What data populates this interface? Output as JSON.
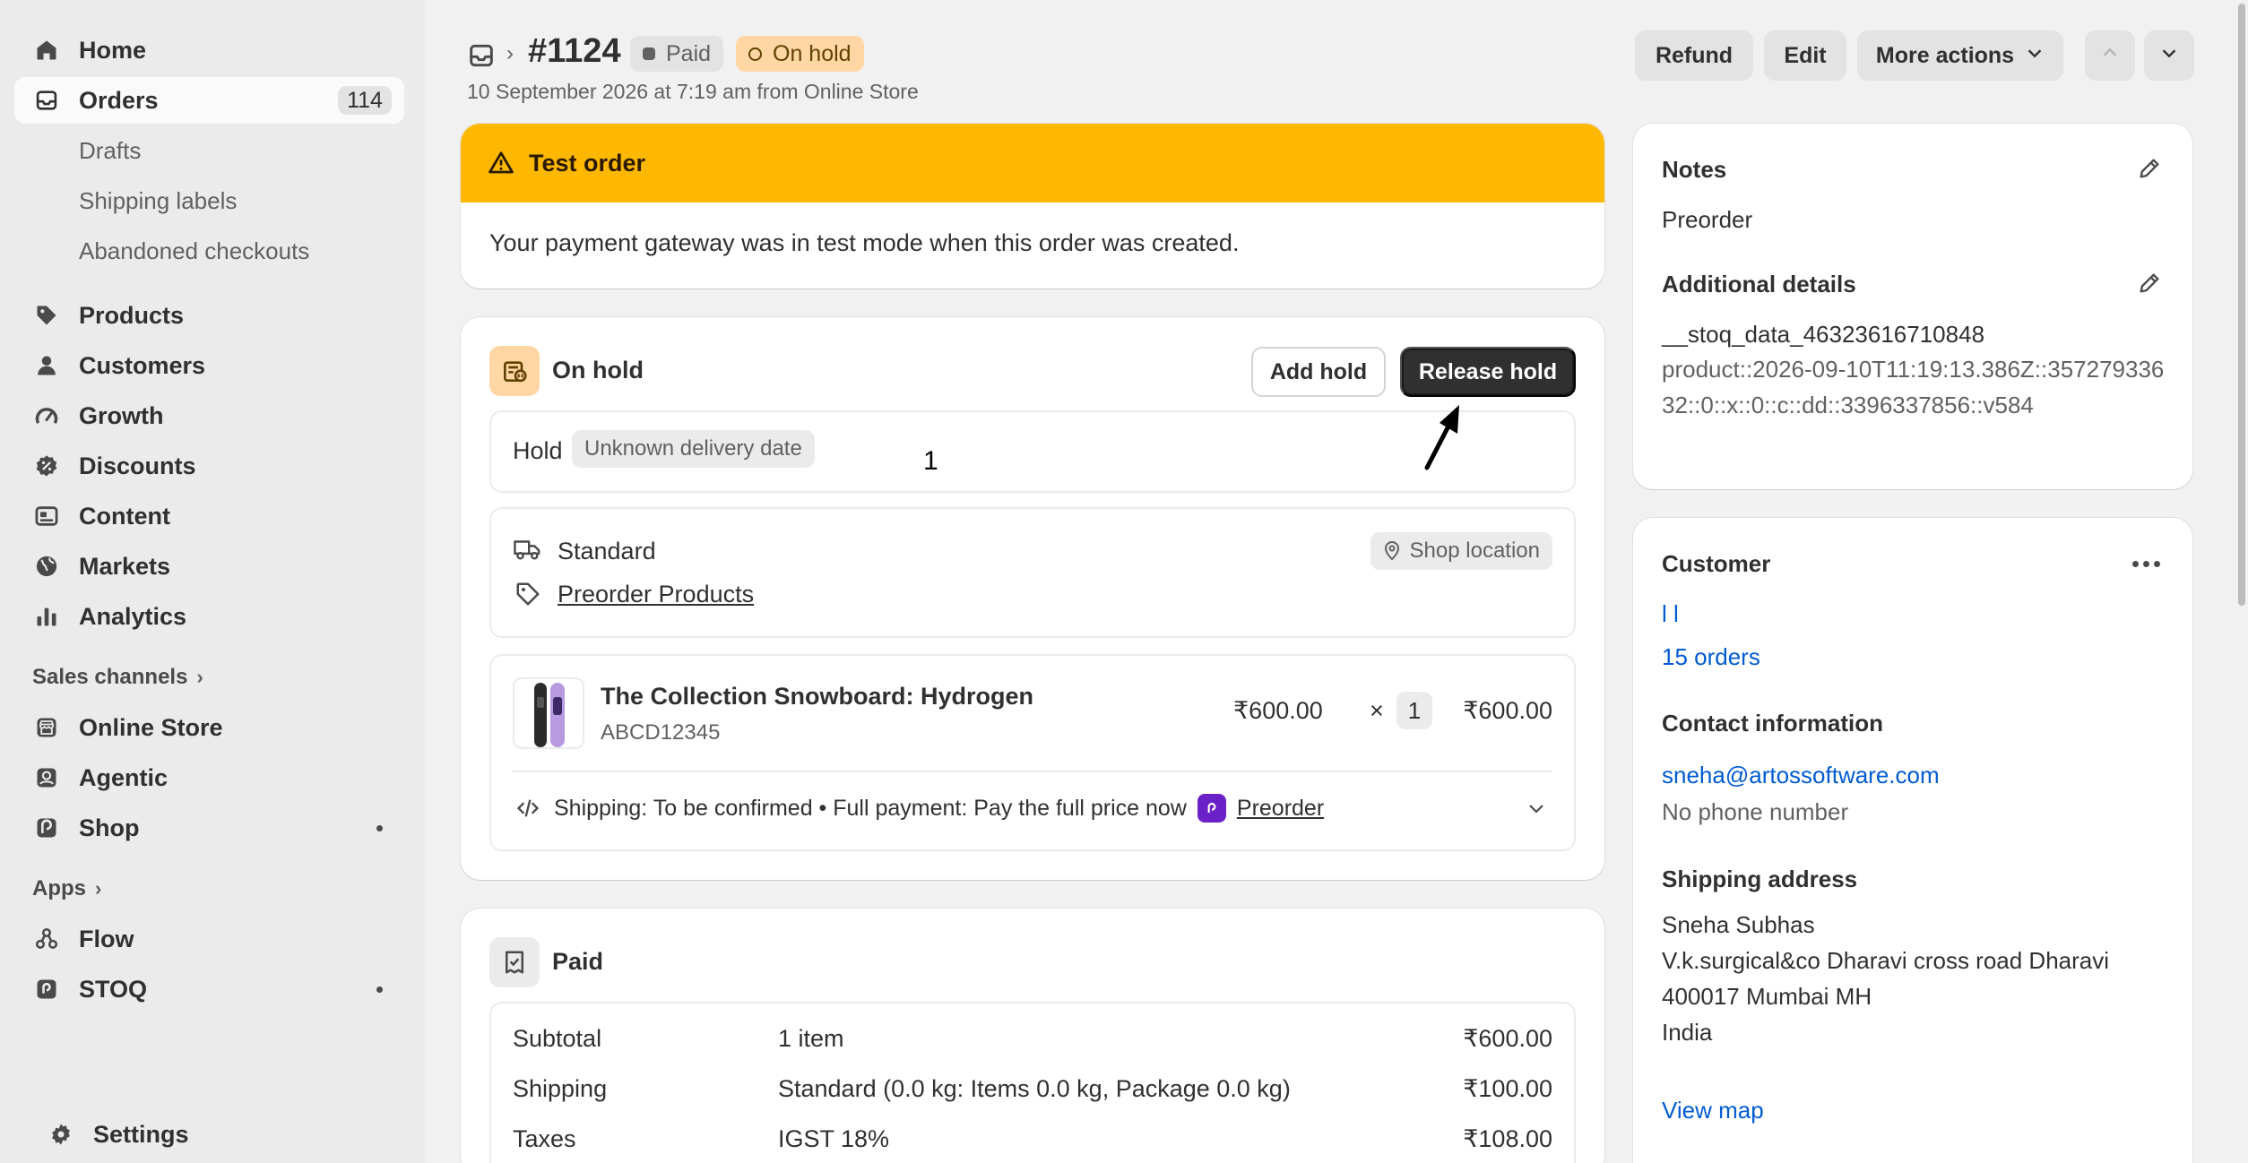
{
  "sidebar": {
    "items": [
      {
        "label": "Home",
        "icon": "home-icon"
      },
      {
        "label": "Orders",
        "icon": "orders-icon",
        "badge": "114"
      },
      {
        "label": "Drafts"
      },
      {
        "label": "Shipping labels"
      },
      {
        "label": "Abandoned checkouts"
      },
      {
        "label": "Products",
        "icon": "tag-icon"
      },
      {
        "label": "Customers",
        "icon": "person-icon"
      },
      {
        "label": "Growth",
        "icon": "gauge-icon"
      },
      {
        "label": "Discounts",
        "icon": "discount-icon"
      },
      {
        "label": "Content",
        "icon": "content-icon"
      },
      {
        "label": "Markets",
        "icon": "globe-icon"
      },
      {
        "label": "Analytics",
        "icon": "bar-chart-icon"
      }
    ],
    "sales_channels": {
      "label": "Sales channels",
      "items": [
        {
          "label": "Online Store",
          "icon": "store-icon"
        },
        {
          "label": "Agentic",
          "icon": "agentic-icon"
        },
        {
          "label": "Shop",
          "icon": "shop-icon"
        }
      ]
    },
    "apps": {
      "label": "Apps",
      "items": [
        {
          "label": "Flow",
          "icon": "flow-icon"
        },
        {
          "label": "STOQ",
          "icon": "stoq-icon"
        }
      ]
    },
    "settings_label": "Settings"
  },
  "header": {
    "order_number": "#1124",
    "payment_status": "Paid",
    "fulfillment_status": "On hold",
    "subtitle": "10 September 2026 at 7:19 am from Online Store",
    "refund_label": "Refund",
    "edit_label": "Edit",
    "more_actions_label": "More actions"
  },
  "test_order": {
    "title": "Test order",
    "message": "Your payment gateway was in test mode when this order was created."
  },
  "hold_card": {
    "title": "On hold",
    "add_hold_label": "Add hold",
    "release_hold_label": "Release hold",
    "hold_label": "Hold",
    "hold_reason": "Unknown delivery date",
    "annotation": "1",
    "delivery_method": "Standard",
    "location": "Shop location",
    "product_collection": "Preorder Products",
    "item": {
      "name": "The Collection Snowboard: Hydrogen",
      "sku": "ABCD12345",
      "unit_price": "₹600.00",
      "times": "×",
      "quantity": "1",
      "total": "₹600.00",
      "meta": "Shipping: To be confirmed • Full payment: Pay the full price now",
      "app_link": "Preorder"
    }
  },
  "paid_card": {
    "title": "Paid",
    "rows": [
      {
        "label": "Subtotal",
        "detail": "1 item",
        "amount": "₹600.00"
      },
      {
        "label": "Shipping",
        "detail": "Standard (0.0 kg: Items 0.0 kg, Package 0.0 kg)",
        "amount": "₹100.00"
      },
      {
        "label": "Taxes",
        "detail": "IGST 18%",
        "amount": "₹108.00"
      }
    ]
  },
  "notes_card": {
    "notes_title": "Notes",
    "notes_text": "Preorder",
    "additional_title": "Additional details",
    "additional_key": "__stoq_data_46323616710848",
    "additional_value": "product::2026-09-10T11:19:13.386Z::35727933632::0::x::0::c::dd::3396337856::v584"
  },
  "customer_card": {
    "title": "Customer",
    "name": "l l",
    "orders": "15 orders",
    "contact_title": "Contact information",
    "email": "sneha@artossoftware.com",
    "phone": "No phone number",
    "shipping_title": "Shipping address",
    "address_lines": [
      "Sneha Subhas",
      "V.k.surgical&co Dharavi cross road Dharavi",
      "400017 Mumbai MH",
      "India"
    ],
    "view_map": "View map"
  },
  "colors": {
    "banner": "#ffb800",
    "hold_badge": "#ffd6a4",
    "primary_button": "#303030",
    "link": "#005bd3"
  }
}
